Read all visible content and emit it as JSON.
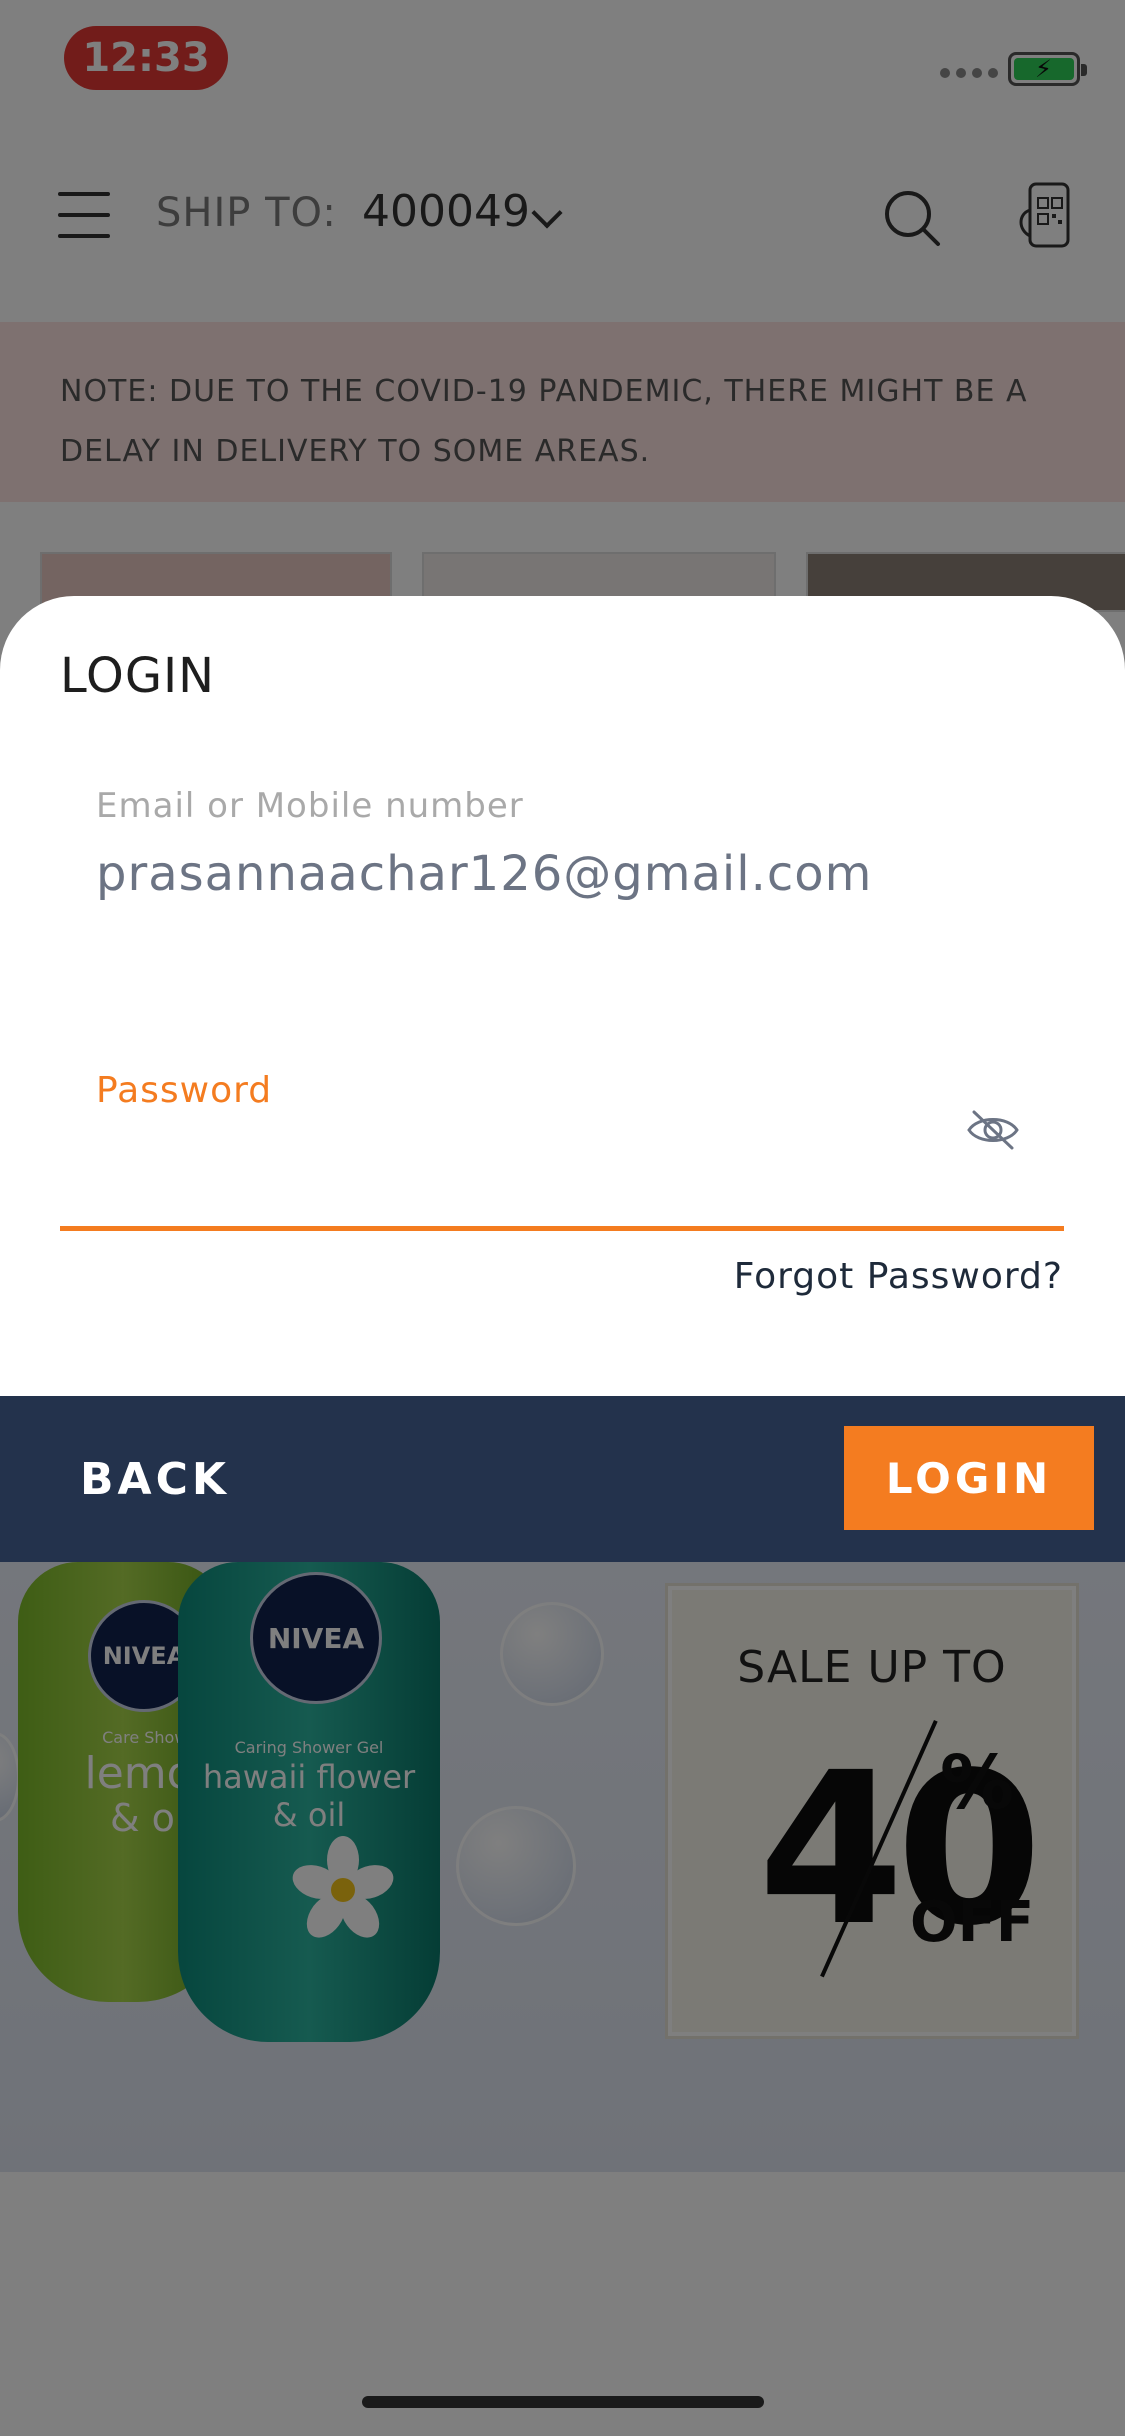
{
  "status_bar": {
    "time": "12:33"
  },
  "header": {
    "ship_to_label": "SHIP TO:",
    "pincode": "400049"
  },
  "notice": {
    "text": "NOTE: DUE TO THE COVID-19 PANDEMIC, THERE MIGHT BE A DELAY IN DELIVERY TO SOME AREAS."
  },
  "banner": {
    "brand": "NIVEA",
    "product_left": {
      "line1": "Care Shower",
      "line2": "lemon",
      "line3": "& oil"
    },
    "product_right": {
      "line1": "Caring Shower Gel",
      "line2": "hawaii flower",
      "line3": "& oil"
    },
    "sale_heading": "SALE UP TO",
    "sale_number": "40",
    "sale_percent": "%",
    "sale_off": "OFF"
  },
  "login_modal": {
    "title": "LOGIN",
    "email_label": "Email or Mobile number",
    "email_value": "prasannaachar126@gmail.com",
    "password_label": "Password",
    "forgot_link": "Forgot Password?",
    "back_button": "BACK",
    "login_button": "LOGIN"
  },
  "colors": {
    "accent": "#f47c20",
    "action_bar": "#23324c",
    "time_pill": "#e53935"
  },
  "icons": [
    "menu-icon",
    "chevron-down-icon",
    "search-icon",
    "barcode-scan-icon",
    "eye-off-icon",
    "battery-icon"
  ]
}
